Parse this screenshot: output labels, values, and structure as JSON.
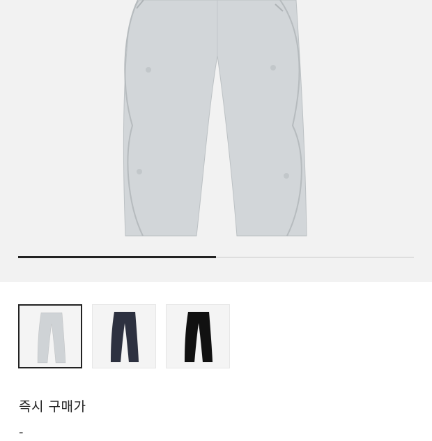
{
  "product": {
    "image_icon": "pants-image",
    "image_color": "#cfd3d6"
  },
  "gallery": {
    "progress": 0.5
  },
  "thumbnails": [
    {
      "color": "#cfd3d6",
      "selected": true
    },
    {
      "color": "#2d3140",
      "selected": false
    },
    {
      "color": "#111111",
      "selected": false
    }
  ],
  "price": {
    "label": "즉시 구매가",
    "value": "-"
  }
}
